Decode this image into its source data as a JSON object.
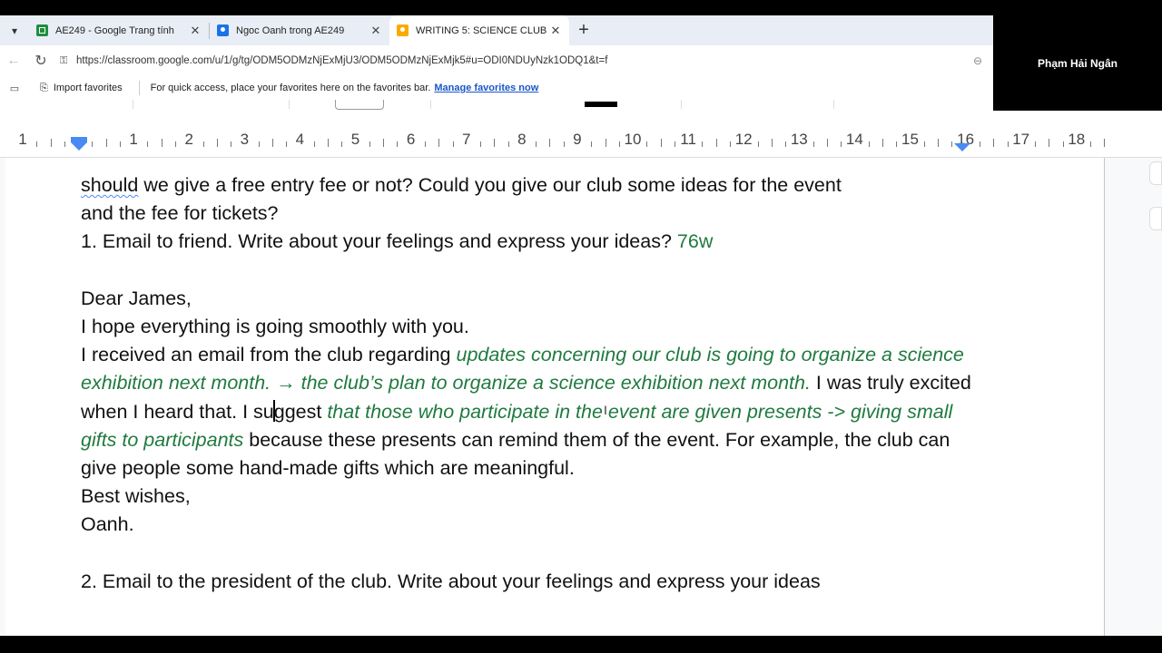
{
  "tabs": [
    {
      "title": "AE249 - Google Trang tính",
      "favicon": "sheets-icon",
      "active": false
    },
    {
      "title": "Ngoc Oanh trong AE249",
      "favicon": "classroom-icon",
      "active": false
    },
    {
      "title": "WRITING 5: SCIENCE CLUB",
      "favicon": "assignment-icon",
      "active": true
    }
  ],
  "icons": {
    "tab_menu": "▾",
    "close": "✕",
    "new_tab": "+",
    "back": "←",
    "reload": "↻",
    "lock": "⚿",
    "zoom": "⊖",
    "sidebar": "▭",
    "import": "⎘"
  },
  "address": {
    "url": "https://classroom.google.com/u/1/g/tg/ODM5ODMzNjExMjU3/ODM5ODMzNjExMjk5#u=ODI0NDUyNzk1ODQ1&t=f"
  },
  "favorites": {
    "import_label": "Import favorites",
    "hint": "For quick access, place your favorites here on the favorites bar.",
    "manage_link": "Manage favorites now"
  },
  "webcam": {
    "name": "Phạm Hải Ngân"
  },
  "ruler": {
    "labels": [
      "1",
      "1",
      "2",
      "3",
      "4",
      "5",
      "6",
      "7",
      "8",
      "9",
      "10",
      "11",
      "12",
      "13",
      "14",
      "15",
      "16",
      "17",
      "18"
    ]
  },
  "doc": {
    "l1_a": "should",
    "l1_b": " we give a free entry fee or not? Could you give our club some ideas for the event",
    "l2": "and the fee for tickets?",
    "l3_a": "1. Email to friend. Write about your feelings and express your ideas? ",
    "l3_b": "76w",
    "greeting": "Dear James,",
    "hope": "I hope everything is going smoothly with you.",
    "para_a": "I received an email from the club regarding ",
    "para_b": "updates concerning our club is going to organize a science exhibition next month. →  the club’s plan to organize a science exhibition next month.",
    "para_c": " I was truly excited when I heard that. I su",
    "para_d": "ggest ",
    "para_e": "that those who participate in the event are given presents -> giving small gifts to participants",
    "para_f": " because these presents can remind them of the event. For example, the club can give people some hand-made gifts which are meaningful.",
    "closing": "Best wishes,",
    "signature": "Oanh.",
    "l_task2": "2. Email to the president of the club. Write about your feelings and express your ideas"
  }
}
